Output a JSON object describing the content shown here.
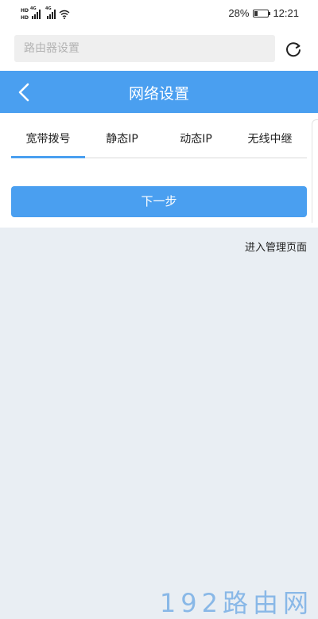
{
  "status_bar": {
    "hd_labels": [
      "HD",
      "HD"
    ],
    "network_labels": [
      "4G",
      "4G"
    ],
    "battery_percent": "28%",
    "battery_level": 0.28,
    "time": "12:21"
  },
  "search": {
    "placeholder": "路由器设置",
    "refresh_icon": "refresh-icon"
  },
  "header": {
    "title": "网络设置",
    "back_icon": "chevron-left-icon"
  },
  "tabs": [
    {
      "label": "宽带拨号",
      "active": true
    },
    {
      "label": "静态IP",
      "active": false
    },
    {
      "label": "动态IP",
      "active": false
    },
    {
      "label": "无线中继",
      "active": false
    }
  ],
  "actions": {
    "next_label": "下一步",
    "admin_link": "进入管理页面"
  },
  "watermark": "192路由网",
  "colors": {
    "accent": "#4a9ff0",
    "background": "#e9eef3",
    "watermark": "#7fb3e6"
  }
}
